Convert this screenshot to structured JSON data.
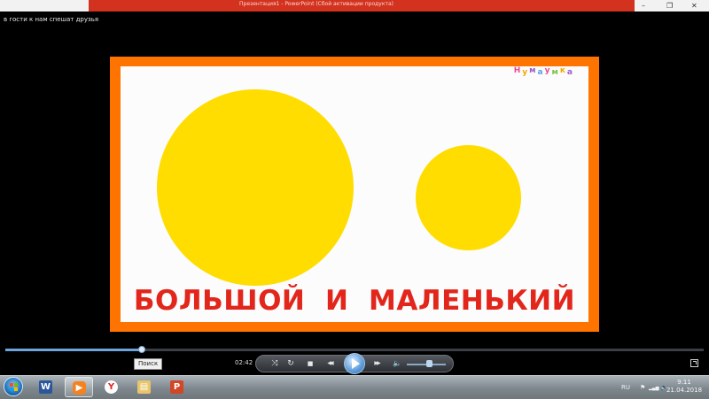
{
  "window": {
    "caption": "Презентация1 - PowerPoint (Сбой активации продукта)",
    "player_title": "в гости к нам спешат друзья",
    "controls": {
      "minimize_glyph": "–",
      "restore_glyph": "❐",
      "close_glyph": "✕"
    }
  },
  "slide": {
    "background_color": "#fcfcfc",
    "border_color": "#ff7300",
    "circle_color": "#ffdd00",
    "caption": "БОЛЬШОЙ  И  МАЛЕНЬКИЙ",
    "caption_color": "#e2261b",
    "logo_letters": [
      "Н",
      "у",
      "м",
      "а",
      "у",
      "м",
      "к",
      "а"
    ],
    "logo_colors": [
      "#e94b8b",
      "#f2a900",
      "#a05cc4",
      "#5aa0e6",
      "#e94b8b",
      "#7cc242",
      "#f2a900",
      "#a05cc4"
    ]
  },
  "player": {
    "seek_progress": 0.196,
    "tooltip": "Поиск",
    "time": "02:42",
    "volume_level": 0.55,
    "icons": {
      "shuffle": "⤨",
      "repeat": "↻",
      "stop": "■",
      "previous": "◀◀",
      "next": "▶▶",
      "volume": "🔈"
    }
  },
  "taskbar": {
    "apps": [
      {
        "name": "word",
        "glyph": "W",
        "color": "#2b579a",
        "active": false
      },
      {
        "name": "media-player",
        "glyph": "▶",
        "color": "#f58220",
        "active": true
      },
      {
        "name": "yandex-browser",
        "glyph": "Y",
        "color": "#ffffff",
        "active": false
      },
      {
        "name": "explorer",
        "glyph": "▤",
        "color": "#e8c56a",
        "active": false
      },
      {
        "name": "powerpoint",
        "glyph": "P",
        "color": "#d24726",
        "active": false
      }
    ],
    "tray": {
      "language": "RU",
      "flag_glyph": "⚑",
      "network_glyph": "▂▄▆",
      "volume_glyph": "🔈",
      "time": "9:11",
      "date": "21.04.2018"
    }
  }
}
